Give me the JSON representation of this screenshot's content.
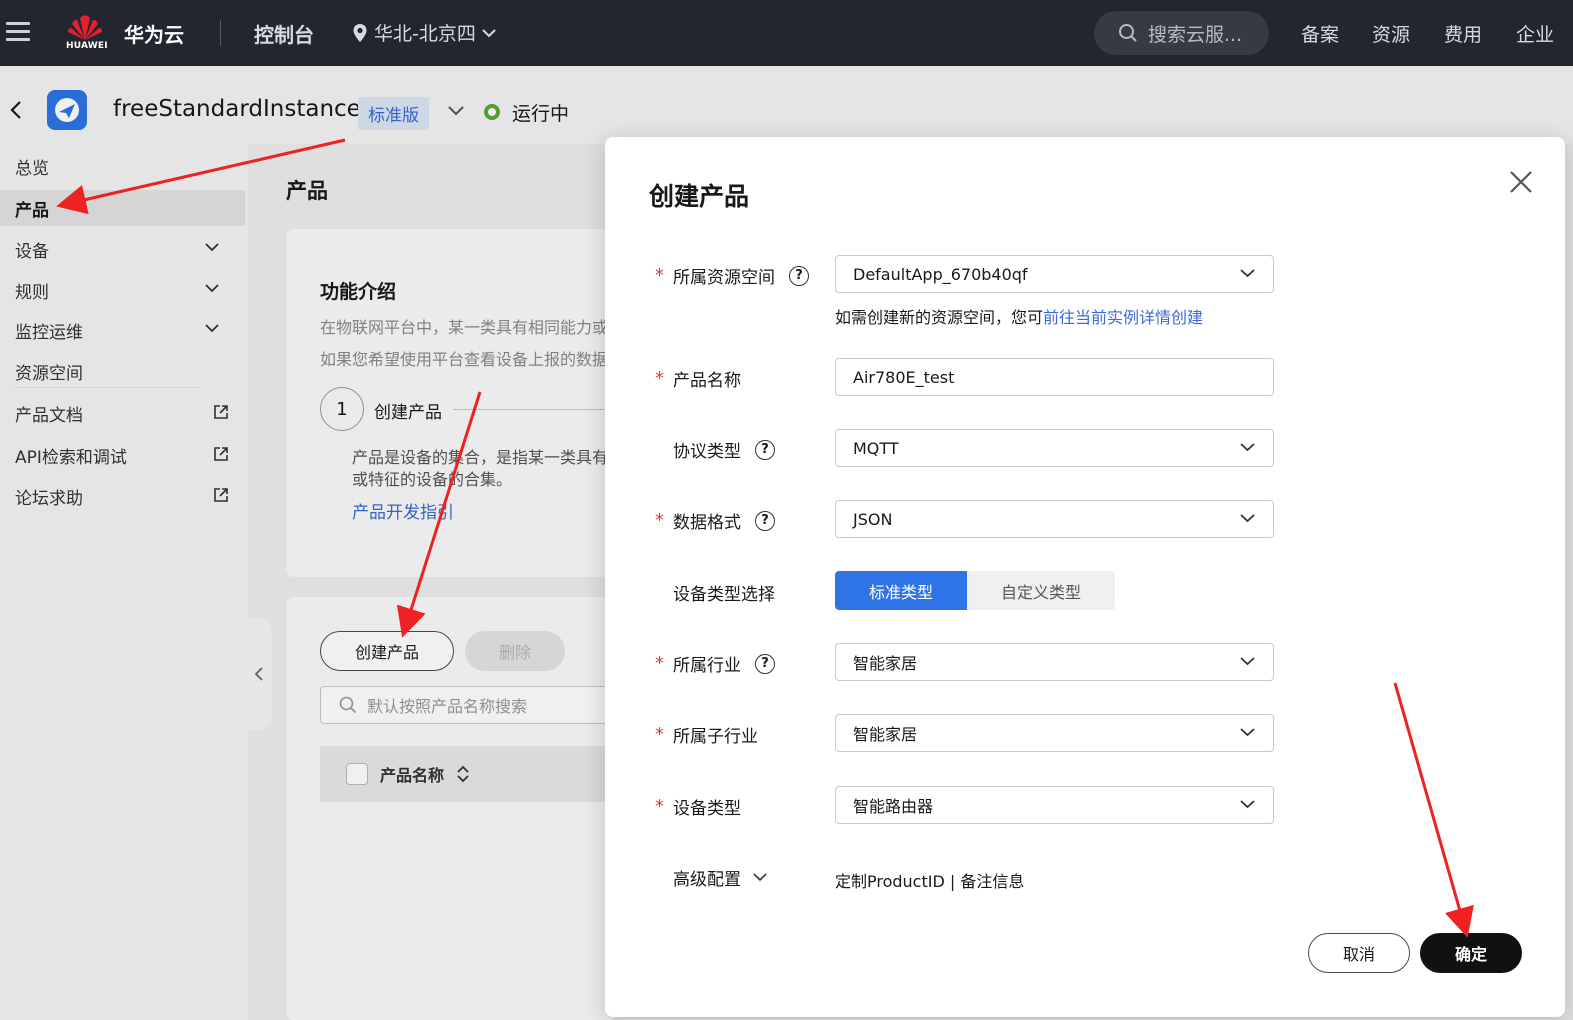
{
  "topbar": {
    "logo_text": "HUAWEI",
    "brand": "华为云",
    "console": "控制台",
    "region": "华北-北京四",
    "search_placeholder": "搜索云服...",
    "nav": [
      "备案",
      "资源",
      "费用",
      "企业"
    ]
  },
  "instance": {
    "name": "freeStandardInstance",
    "edition": "标准版",
    "status": "运行中"
  },
  "sidebar": {
    "items": [
      {
        "label": "总览"
      },
      {
        "label": "产品"
      },
      {
        "label": "设备"
      },
      {
        "label": "规则"
      },
      {
        "label": "监控运维"
      },
      {
        "label": "资源空间"
      },
      {
        "label": "产品文档"
      },
      {
        "label": "API检索和调试"
      },
      {
        "label": "论坛求助"
      }
    ]
  },
  "main": {
    "title": "产品",
    "feature_title": "功能介绍",
    "feature_lines": [
      "在物联网平台中，某一类具有相同能力或",
      "如果您希望使用平台查看设备上报的数据"
    ],
    "step_number": "1",
    "step_label": "创建产品",
    "step_desc": [
      "产品是设备的集合，是指某一类具有",
      "或特征的设备的合集。"
    ],
    "step_link": "产品开发指引",
    "create_button": "创建产品",
    "delete_button": "删除",
    "search_placeholder": "默认按照产品名称搜索",
    "table_header": "产品名称"
  },
  "modal": {
    "title": "创建产品",
    "fields": {
      "resource_space": {
        "label": "所属资源空间",
        "value": "DefaultApp_670b40qf"
      },
      "hint_text": "如需创建新的资源空间，您可",
      "hint_link": "前往当前实例详情创建",
      "product_name": {
        "label": "产品名称",
        "value": "Air780E_test"
      },
      "protocol": {
        "label": "协议类型",
        "value": "MQTT"
      },
      "data_format": {
        "label": "数据格式",
        "value": "JSON"
      },
      "device_type_choice": {
        "label": "设备类型选择",
        "options": [
          "标准类型",
          "自定义类型"
        ]
      },
      "industry": {
        "label": "所属行业",
        "value": "智能家居"
      },
      "sub_industry": {
        "label": "所属子行业",
        "value": "智能家居"
      },
      "device_type": {
        "label": "设备类型",
        "value": "智能路由器"
      },
      "advanced": {
        "label": "高级配置",
        "value": "定制ProductID | 备注信息"
      }
    },
    "help_glyph": "?",
    "required_mark": "*",
    "cancel": "取消",
    "confirm": "确定"
  },
  "colors": {
    "topbar": "#22262e",
    "accent": "#2e74e6",
    "link": "#3a6ad6",
    "required": "#e23a3a",
    "annotation_arrow": "#ee2222",
    "status_running": "#5aa63a"
  }
}
